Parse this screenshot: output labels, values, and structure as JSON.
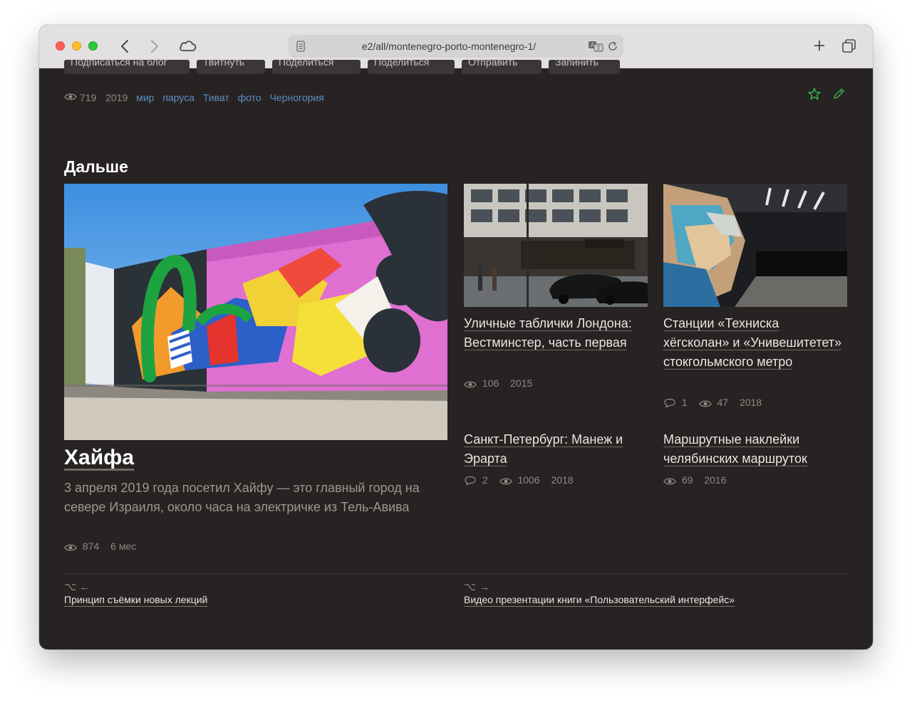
{
  "browser": {
    "url": "e2/all/montenegro-porto-montenegro-1/",
    "icons": [
      "back-icon",
      "forward-icon",
      "cloud-icon",
      "reader-icon",
      "translate-icon",
      "reload-icon",
      "new-tab-icon",
      "tabs-overview-icon"
    ]
  },
  "share_buttons": [
    "Подписаться на блог",
    "Твитнуть",
    "Поделиться",
    "Поделиться",
    "Отправить",
    "Запинить"
  ],
  "post_meta": {
    "views": "719",
    "year": "2019",
    "tags": [
      "мир",
      "паруса",
      "Тиват",
      "фото",
      "Черногория"
    ]
  },
  "colors": {
    "background": "#262322",
    "accent_green": "#3ab54a",
    "tag_blue": "#5e8fc3"
  },
  "next_section": {
    "title": "Дальше",
    "featured": {
      "title": "Хайфа",
      "description": "3 апреля 2019 года посетил Хайфу — это главный город на севере Израиля, около часа на электричке из Тель-Авива",
      "views": "874",
      "age": "6 мес"
    },
    "cards": [
      {
        "title": "Уличные таблички Лондона: Вестминстер, часть первая",
        "views": "106",
        "year": "2015"
      },
      {
        "title": "Станции «Техниска хёгсколан» и «Унивешитетет» стокгольмского метро",
        "comments": "1",
        "views": "47",
        "year": "2018"
      },
      {
        "title": "Санкт-Петербург: Манеж и Эрарта",
        "comments": "2",
        "views": "1006",
        "year": "2018"
      },
      {
        "title": "Маршрутные наклейки челябинских маршруток",
        "views": "69",
        "year": "2016"
      }
    ]
  },
  "pagination": {
    "prev_shortcut": "⌥ ←",
    "prev_title": "Принцип съёмки новых лекций",
    "next_shortcut": "⌥ →",
    "next_title": "Видео презентации книги «Пользовательский интерфейс»"
  }
}
